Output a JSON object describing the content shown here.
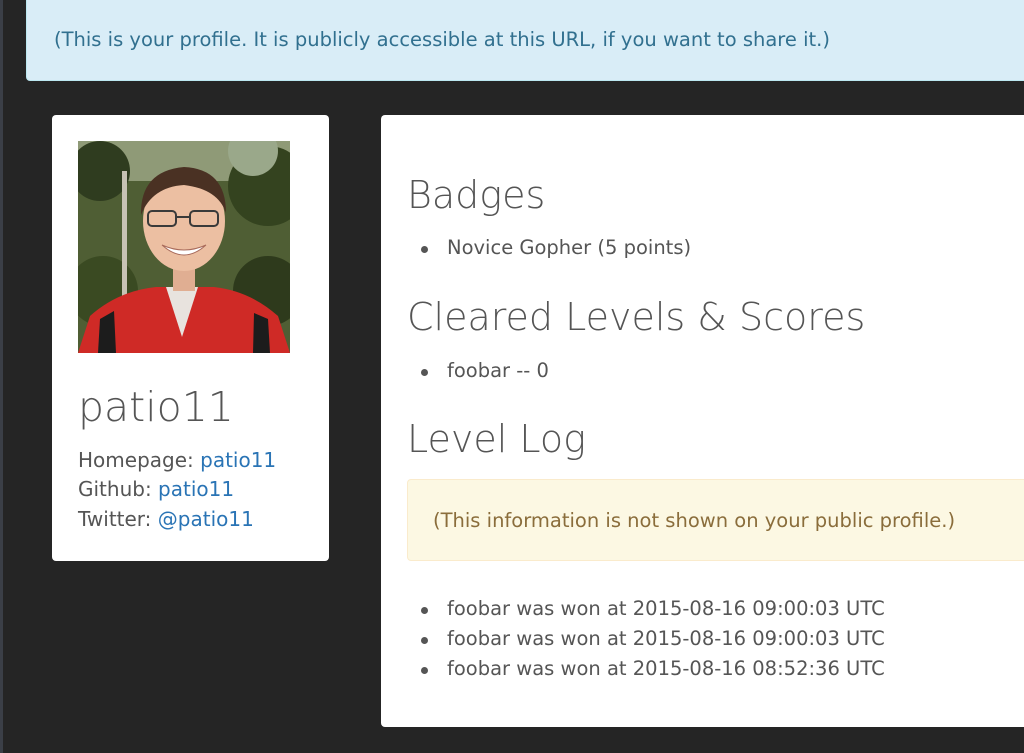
{
  "banner": {
    "text": "(This is your profile. It is publicly accessible at this URL, if you want to share it.)"
  },
  "profile": {
    "username": "patio11",
    "links": [
      {
        "label": "Homepage:",
        "value": "patio11"
      },
      {
        "label": "Github:",
        "value": "patio11"
      },
      {
        "label": "Twitter:",
        "value": "@patio11"
      }
    ]
  },
  "badges": {
    "heading": "Badges",
    "items": [
      "Novice Gopher (5 points)"
    ]
  },
  "cleared": {
    "heading": "Cleared Levels & Scores",
    "items": [
      "foobar -- 0"
    ]
  },
  "level_log": {
    "heading": "Level Log",
    "notice": "(This information is not shown on your public profile.)",
    "entries": [
      "foobar was won at 2015-08-16 09:00:03 UTC",
      "foobar was won at 2015-08-16 09:00:03 UTC",
      "foobar was won at 2015-08-16 08:52:36 UTC"
    ]
  },
  "colors": {
    "info_bg": "#d9edf7",
    "info_text": "#31708f",
    "warning_bg": "#fcf8e3",
    "warning_text": "#8a6d3b",
    "link": "#2a74b5",
    "page_bg": "#252525"
  }
}
